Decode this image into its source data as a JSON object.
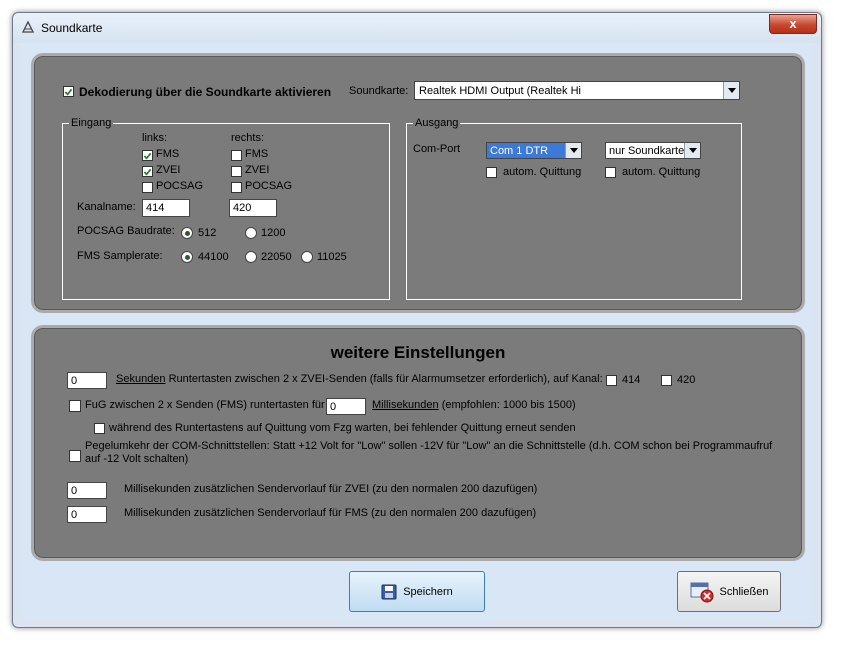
{
  "window": {
    "title": "Soundkarte",
    "close_label": "x"
  },
  "top": {
    "decode_checkbox": {
      "label": "Dekodierung über die Soundkarte aktivieren",
      "checked": true
    },
    "soundcard_label": "Soundkarte:",
    "soundcard_value": "Realtek HDMI Output (Realtek Hi",
    "eingang": {
      "legend": "Eingang",
      "links_header": "links:",
      "rechts_header": "rechts:",
      "left": [
        {
          "label": "FMS",
          "checked": true
        },
        {
          "label": "ZVEI",
          "checked": true
        },
        {
          "label": "POCSAG",
          "checked": false
        }
      ],
      "right": [
        {
          "label": "FMS",
          "checked": false
        },
        {
          "label": "ZVEI",
          "checked": false
        },
        {
          "label": "POCSAG",
          "checked": false
        }
      ],
      "kanalname_label": "Kanalname:",
      "kanal_left": "414",
      "kanal_right": "420",
      "pocsag_label": "POCSAG Baudrate:",
      "pocsag_options": [
        "512",
        "1200"
      ],
      "pocsag_selected": "512",
      "fms_label": "FMS Samplerate:",
      "fms_options": [
        "44100",
        "22050",
        "11025"
      ],
      "fms_selected": "44100"
    },
    "ausgang": {
      "legend": "Ausgang",
      "comport_label": "Com-Port",
      "com_value": "Com 1 DTR",
      "mode_value": "nur Soundkarte",
      "quitt_left": "autom. Quittung",
      "quitt_right": "autom. Quittung"
    }
  },
  "bottom": {
    "heading": "weitere Einstellungen",
    "row1": {
      "value": "0",
      "unit": "Sekunden",
      "text": " Runtertasten zwischen 2 x ZVEI-Senden (falls für Alarmumsetzer erforderlich), auf Kanal:",
      "chan1": "414",
      "chan2": "420"
    },
    "row2": {
      "text": "FuG zwischen 2 x Senden (FMS) runtertasten für",
      "value": "0",
      "unit": "Millisekunden",
      "hint": " (empfohlen: 1000 bis 1500)"
    },
    "row3": {
      "text": "während des Runtertastens auf Quittung vom Fzg warten, bei fehlender Quittung erneut senden"
    },
    "row4": {
      "text": "Pegelumkehr der COM-Schnittstellen: Statt +12 Volt for \"Low\" sollen -12V für \"Low\" an die Schnittstelle (d.h. COM schon bei Programmaufruf auf -12 Volt schalten)"
    },
    "row5": {
      "value": "0",
      "text": "Millisekunden zusätzlichen Sendervorlauf für ZVEI (zu den normalen 200  dazufügen)"
    },
    "row6": {
      "value": "0",
      "text": "Millisekunden zusätzlichen Sendervorlauf für FMS (zu den normalen 200  dazufügen)"
    }
  },
  "buttons": {
    "save": "Speichern",
    "close": "Schließen"
  },
  "colors": {
    "panel": "#7b7b7b",
    "window": "#d9e6f5",
    "selection": "#3d7ad6"
  }
}
